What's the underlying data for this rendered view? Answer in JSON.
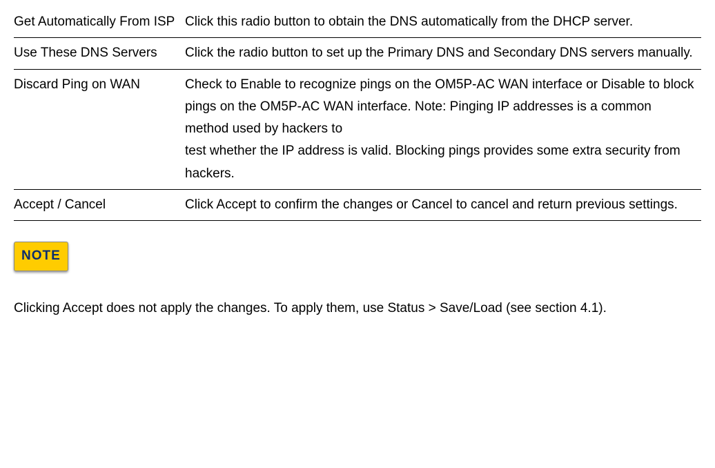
{
  "table": {
    "rows": [
      {
        "label": "Get Automatically From ISP",
        "desc": "Click this radio button to obtain the DNS automatically from the DHCP server."
      },
      {
        "label": "Use These DNS Servers",
        "desc": "Click the radio button to set up the Primary DNS and Secondary DNS servers manually."
      },
      {
        "label": "Discard Ping on WAN",
        "desc": "Check to Enable to recognize pings on the OM5P-AC WAN interface or Disable to block pings on the OM5P-AC WAN interface. Note: Pinging IP addresses is a common method used by hackers to\ntest whether the IP address is valid. Blocking pings provides some extra security from hackers."
      },
      {
        "label": "Accept / Cancel",
        "desc": "Click Accept to confirm the changes or Cancel to cancel and return previous settings."
      }
    ]
  },
  "note": {
    "badge": "NOTE",
    "text": "Clicking Accept does not apply the changes. To apply them, use Status > Save/Load (see section 4.1)."
  }
}
